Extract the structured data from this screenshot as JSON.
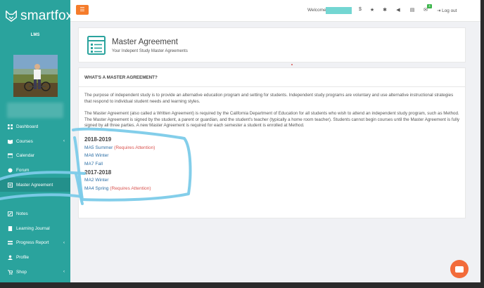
{
  "brand": {
    "name": "smartfox"
  },
  "sidebar": {
    "role": "LMS",
    "items": [
      {
        "label": "Dashboard",
        "icon": "dashboard-icon",
        "chevron": false
      },
      {
        "label": "Courses",
        "icon": "book-icon",
        "chevron": true
      },
      {
        "label": "Calendar",
        "icon": "calendar-icon",
        "chevron": false
      },
      {
        "label": "Forum",
        "icon": "globe-icon",
        "chevron": false
      },
      {
        "label": "Master Agreement",
        "icon": "document-icon",
        "chevron": false,
        "active": true
      },
      {
        "label": "",
        "icon": "",
        "chevron": false
      },
      {
        "label": "Notes",
        "icon": "notes-icon",
        "chevron": false
      },
      {
        "label": "Learning Journal",
        "icon": "journal-icon",
        "chevron": false
      },
      {
        "label": "Progress Report",
        "icon": "report-icon",
        "chevron": true
      },
      {
        "label": "Profile",
        "icon": "user-icon",
        "chevron": false
      },
      {
        "label": "Shop",
        "icon": "cart-icon",
        "chevron": true
      }
    ]
  },
  "topbar": {
    "welcome": "Welcome",
    "notification_count": "4",
    "logout": "Log out"
  },
  "header": {
    "title": "Master Agreement",
    "subtitle": "Your Indepent Study Master Agreements"
  },
  "main": {
    "heading": "WHAT'S A MASTER AGREEMENT?",
    "para1": "The purpose of independent study is to provide an alternative education program and setting for students. Independent study programs are voluntary and use alternative instructional strategies that respond to individual student needs and learning styles.",
    "para2": "The Master Agreement (also called a Written Agreement) is required by the California Department of Education for all students who wish to attend an independent study program, such as Method. The Master Agreement is signed by the student, a parent or guardian, and the student's teacher (typically a home room teacher). Students cannot begin courses until the Master Agreement is fully signed by all three parties. A new Master Agreement is required for each semester a student is enrolled at Method.",
    "years": [
      {
        "year": "2018-2019",
        "agreements": [
          {
            "label": "MA5 Summer",
            "status": "(Requires Attention)"
          },
          {
            "label": "MA6 Winter",
            "status": ""
          },
          {
            "label": "MA7 Fall",
            "status": ""
          }
        ]
      },
      {
        "year": "2017-2018",
        "agreements": [
          {
            "label": "MA2 Winter",
            "status": ""
          },
          {
            "label": "MA4 Spring",
            "status": "(Requires Attention)"
          }
        ]
      }
    ]
  },
  "colors": {
    "sidebar": "#2aa39d",
    "accent_orange": "#f57c2b",
    "link": "#2d6fa5",
    "attention": "#d9534f",
    "annotation": "#7ccbe9"
  }
}
